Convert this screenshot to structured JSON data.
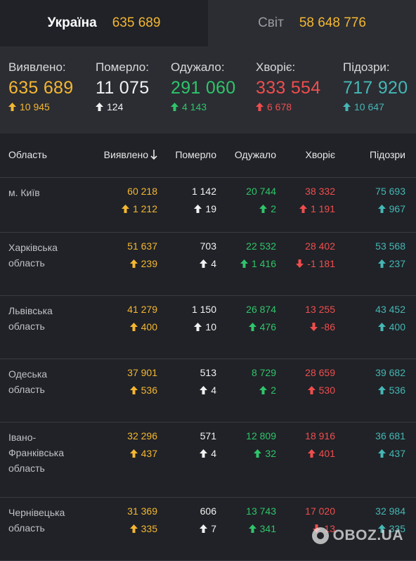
{
  "tabs": [
    {
      "label": "Україна",
      "value": "635 689"
    },
    {
      "label": "Світ",
      "value": "58 648 776"
    }
  ],
  "summary": [
    {
      "label": "Виявлено:",
      "value": "635 689",
      "delta": "10 945",
      "color": "#f5b731"
    },
    {
      "label": "Померло:",
      "value": "11 075",
      "delta": "124",
      "color": "#f2f2f2"
    },
    {
      "label": "Одужало:",
      "value": "291 060",
      "delta": "4 143",
      "color": "#2fc56a"
    },
    {
      "label": "Хворіє:",
      "value": "333 554",
      "delta": "6 678",
      "color": "#f04d4d"
    },
    {
      "label": "Підозри:",
      "value": "717 920",
      "delta": "10 647",
      "color": "#45b7b5"
    }
  ],
  "table": {
    "headers": [
      "Область",
      "Виявлено",
      "Померло",
      "Одужало",
      "Хворіє",
      "Підозри"
    ],
    "sort_icon": "arrow-down-icon",
    "rows": [
      {
        "region": "м. Київ",
        "cells": [
          {
            "v": "60 218",
            "d": "1 212",
            "dir": "up"
          },
          {
            "v": "1 142",
            "d": "19",
            "dir": "up"
          },
          {
            "v": "20 744",
            "d": "2",
            "dir": "up"
          },
          {
            "v": "38 332",
            "d": "1 191",
            "dir": "up"
          },
          {
            "v": "75 693",
            "d": "967",
            "dir": "up"
          }
        ]
      },
      {
        "region": "Харківська область",
        "cells": [
          {
            "v": "51 637",
            "d": "239",
            "dir": "up"
          },
          {
            "v": "703",
            "d": "4",
            "dir": "up"
          },
          {
            "v": "22 532",
            "d": "1 416",
            "dir": "up"
          },
          {
            "v": "28 402",
            "d": "-1 181",
            "dir": "down"
          },
          {
            "v": "53 568",
            "d": "237",
            "dir": "up"
          }
        ]
      },
      {
        "region": "Львівська область",
        "cells": [
          {
            "v": "41 279",
            "d": "400",
            "dir": "up"
          },
          {
            "v": "1 150",
            "d": "10",
            "dir": "up"
          },
          {
            "v": "26 874",
            "d": "476",
            "dir": "up"
          },
          {
            "v": "13 255",
            "d": "-86",
            "dir": "down"
          },
          {
            "v": "43 452",
            "d": "400",
            "dir": "up"
          }
        ]
      },
      {
        "region": "Одеська область",
        "cells": [
          {
            "v": "37 901",
            "d": "536",
            "dir": "up"
          },
          {
            "v": "513",
            "d": "4",
            "dir": "up"
          },
          {
            "v": "8 729",
            "d": "2",
            "dir": "up"
          },
          {
            "v": "28 659",
            "d": "530",
            "dir": "up"
          },
          {
            "v": "39 682",
            "d": "536",
            "dir": "up"
          }
        ]
      },
      {
        "region": "Івано-Франківська область",
        "cells": [
          {
            "v": "32 296",
            "d": "437",
            "dir": "up"
          },
          {
            "v": "571",
            "d": "4",
            "dir": "up"
          },
          {
            "v": "12 809",
            "d": "32",
            "dir": "up"
          },
          {
            "v": "18 916",
            "d": "401",
            "dir": "up"
          },
          {
            "v": "36 681",
            "d": "437",
            "dir": "up"
          }
        ]
      },
      {
        "region": "Чернівецька область",
        "cells": [
          {
            "v": "31 369",
            "d": "335",
            "dir": "up"
          },
          {
            "v": "606",
            "d": "7",
            "dir": "up"
          },
          {
            "v": "13 743",
            "d": "341",
            "dir": "up"
          },
          {
            "v": "17 020",
            "d": "13",
            "dir": "down"
          },
          {
            "v": "32 984",
            "d": "335",
            "dir": "up"
          }
        ]
      }
    ]
  },
  "column_colors": [
    "#f5b731",
    "#f2f2f2",
    "#2fc56a",
    "#f04d4d",
    "#45b7b5"
  ],
  "watermark": {
    "text": "OBOZ.UA"
  }
}
